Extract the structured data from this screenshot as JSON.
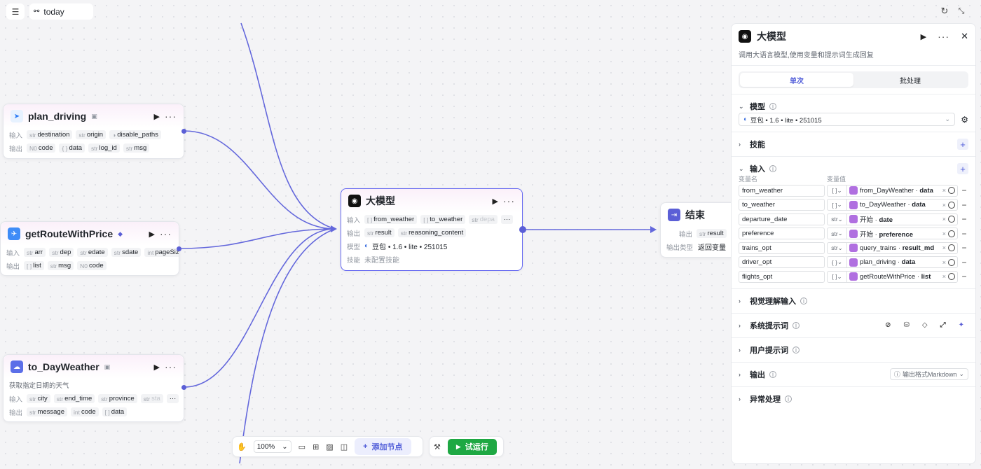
{
  "topbar": {
    "today_label": "today"
  },
  "colors": {
    "accent": "#5b5fd6",
    "run_green": "#1ea843",
    "node_icon_purple": "#b06fe0"
  },
  "nodes": {
    "plan_driving": {
      "title": "plan_driving",
      "input_label": "输入",
      "output_label": "输出",
      "inputs": [
        {
          "type": "str",
          "name": "destination"
        },
        {
          "type": "str",
          "name": "origin"
        },
        {
          "type": "◑",
          "name": "disable_paths"
        }
      ],
      "outputs": [
        {
          "type": "N0",
          "name": "code"
        },
        {
          "type": "{ }",
          "name": "data"
        },
        {
          "type": "str",
          "name": "log_id"
        },
        {
          "type": "str",
          "name": "msg"
        }
      ]
    },
    "getRouteWithPrice": {
      "title": "getRouteWithPrice",
      "input_label": "输入",
      "output_label": "输出",
      "inputs": [
        {
          "type": "str",
          "name": "arr"
        },
        {
          "type": "str",
          "name": "dep"
        },
        {
          "type": "str",
          "name": "edate"
        },
        {
          "type": "str",
          "name": "sdate"
        },
        {
          "type": "int",
          "name": "pageSize"
        }
      ],
      "outputs": [
        {
          "type": "[ ]",
          "name": "list"
        },
        {
          "type": "str",
          "name": "msg"
        },
        {
          "type": "N0",
          "name": "code"
        }
      ]
    },
    "to_DayWeather": {
      "title": "to_DayWeather",
      "desc": "获取指定日期的天气",
      "input_label": "输入",
      "output_label": "输出",
      "inputs": [
        {
          "type": "str",
          "name": "city"
        },
        {
          "type": "str",
          "name": "end_time"
        },
        {
          "type": "str",
          "name": "province"
        },
        {
          "type": "str",
          "name": "sta"
        }
      ],
      "outputs": [
        {
          "type": "str",
          "name": "message"
        },
        {
          "type": "int",
          "name": "code"
        },
        {
          "type": "[ ]",
          "name": "data"
        }
      ]
    },
    "llm": {
      "title": "大模型",
      "input_label": "输入",
      "output_label": "输出",
      "model_label": "模型",
      "skill_label": "技能",
      "inputs": [
        {
          "type": "[ ]",
          "name": "from_weather"
        },
        {
          "type": "[ ]",
          "name": "to_weather"
        },
        {
          "type": "str",
          "name": "depa"
        }
      ],
      "outputs": [
        {
          "type": "str",
          "name": "result"
        },
        {
          "type": "str",
          "name": "reasoning_content"
        }
      ],
      "model": "豆包 • 1.6 • lite • 251015",
      "skill": "未配置技能"
    },
    "end": {
      "title": "结束",
      "output_label": "输出",
      "output_type_label": "输出类型",
      "output": {
        "type": "str",
        "name": "result"
      },
      "output_type": "返回变量"
    }
  },
  "panel": {
    "title": "大模型",
    "desc": "调用大语言模型,使用变量和提示词生成回复",
    "tabs": [
      "单次",
      "批处理"
    ],
    "model_section": "模型",
    "model_value": "豆包 • 1.6 • lite • 251015",
    "skills_section": "技能",
    "inputs_section": "输入",
    "var_name_header": "变量名",
    "var_value_header": "变量值",
    "variables": [
      {
        "name": "from_weather",
        "type": "[ ]",
        "node": "from_DayWeather",
        "field": "data"
      },
      {
        "name": "to_weather",
        "type": "[ ]",
        "node": "to_DayWeather",
        "field": "data"
      },
      {
        "name": "departure_date",
        "type": "str",
        "node": "开始",
        "field": "date"
      },
      {
        "name": "preference",
        "type": "str",
        "node": "开始",
        "field": "preference"
      },
      {
        "name": "trains_opt",
        "type": "str",
        "node": "query_trains",
        "field": "result_md"
      },
      {
        "name": "driver_opt",
        "type": "{ }",
        "node": "plan_driving",
        "field": "data"
      },
      {
        "name": "flights_opt",
        "type": "[ ]",
        "node": "getRouteWithPrice",
        "field": "list"
      }
    ],
    "vision_section": "视觉理解输入",
    "system_prompt_section": "系统提示词",
    "user_prompt_section": "用户提示词",
    "output_section": "输出",
    "output_format": "输出格式Markdown",
    "exception_section": "异常处理"
  },
  "toolbar": {
    "zoom": "100%",
    "add_node": "添加节点",
    "test_run": "试运行"
  }
}
